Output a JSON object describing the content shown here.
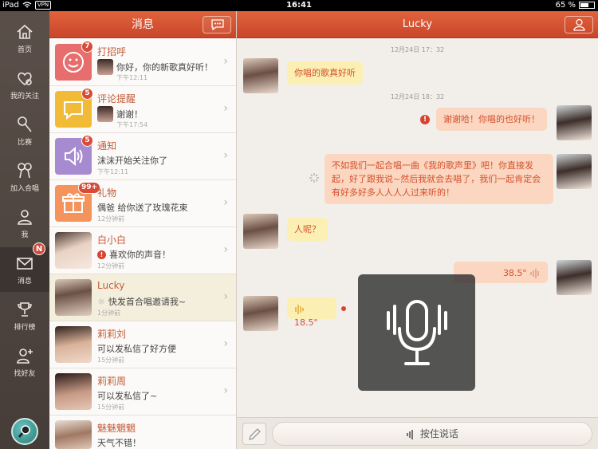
{
  "status_bar": {
    "device": "iPad",
    "vpn": "VPN",
    "time": "16:41",
    "battery": "65 %",
    "battery_level": 0.65
  },
  "nav": {
    "items": [
      {
        "label": "首页",
        "icon": "home-icon"
      },
      {
        "label": "我的关注",
        "icon": "heart-follow-icon"
      },
      {
        "label": "比赛",
        "icon": "microphone-icon"
      },
      {
        "label": "加入合唱",
        "icon": "duet-icon"
      },
      {
        "label": "我",
        "icon": "person-icon"
      },
      {
        "label": "消息",
        "icon": "envelope-icon",
        "badge": "N"
      },
      {
        "label": "排行榜",
        "icon": "trophy-icon"
      },
      {
        "label": "找好友",
        "icon": "add-friend-icon"
      }
    ],
    "search_icon": "search-icon"
  },
  "messages": {
    "title": "消息",
    "items": [
      {
        "name": "打招呼",
        "preview": "你好，你的新歌真好听！",
        "time": "下午12:11",
        "badge": "7",
        "icon": "smile-icon",
        "color": "#e86d6d"
      },
      {
        "name": "评论提醒",
        "preview": "谢谢！",
        "time": "下午17:54",
        "badge": "5",
        "icon": "comment-icon",
        "color": "#f2bb37"
      },
      {
        "name": "通知",
        "preview": "沫沫开始关注你了",
        "time": "下午12:11",
        "badge": "5",
        "icon": "speaker-icon",
        "color": "#a78bd1"
      },
      {
        "name": "礼物",
        "preview": "偶爸 给你送了玫瑰花束",
        "time": "12分钟前",
        "badge": "99+",
        "icon": "gift-icon",
        "color": "#f4935c"
      },
      {
        "name": "白小白",
        "preview": "喜欢你的声音！",
        "time": "12分钟前"
      },
      {
        "name": "Lucky",
        "preview": "快发首合唱邀请我~",
        "time": "1分钟前"
      },
      {
        "name": "莉莉刘",
        "preview": "可以发私信了好方便",
        "time": "15分钟前"
      },
      {
        "name": "莉莉周",
        "preview": "可以发私信了~",
        "time": "15分钟前"
      },
      {
        "name": "魅魅魍魍",
        "preview": "天气不错！"
      }
    ]
  },
  "chat": {
    "title": "Lucky",
    "timestamps": [
      "12月24日  17：32",
      "12月24日  18：32"
    ],
    "messages": [
      {
        "side": "left",
        "text": "你唱的歌真好听"
      },
      {
        "side": "right",
        "text": "谢谢哈！你唱的也好听！",
        "status": "failed"
      },
      {
        "side": "right",
        "text": "不如我们一起合唱一曲《我的歌声里》吧！你直接发起，好了跟我说~然后我就会去唱了，我们一起肯定会有好多好多人人人人过来听的！",
        "status": "sending"
      },
      {
        "side": "left",
        "text": "人呢？"
      },
      {
        "side": "right",
        "voice": "38.5\""
      },
      {
        "side": "left",
        "voice": "18.5\"",
        "status": "unread"
      }
    ],
    "hold_to_talk": "按住说话"
  }
}
